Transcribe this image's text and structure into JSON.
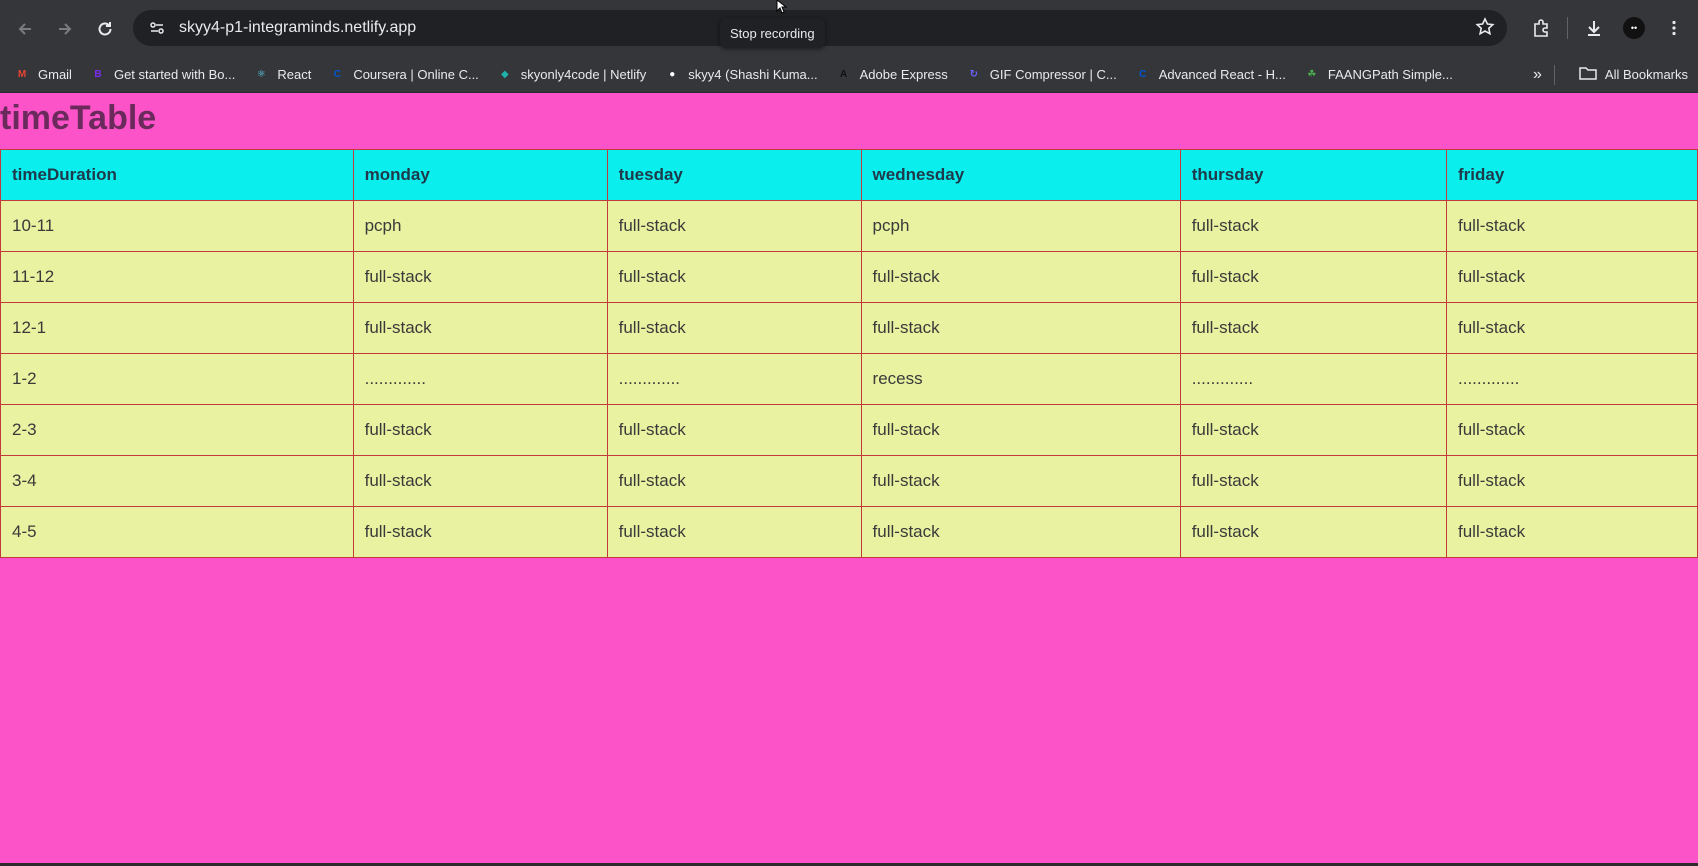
{
  "browser": {
    "url": "skyy4-p1-integraminds.netlify.app",
    "tooltip": "Stop recording",
    "avatar_text": "••",
    "bookmarks": [
      {
        "label": "Gmail",
        "icon": "gmail-icon",
        "color": "#ea4335",
        "glyph": "M"
      },
      {
        "label": "Get started with Bo...",
        "icon": "bootstrap-icon",
        "color": "#7b2cf5",
        "glyph": "B"
      },
      {
        "label": "React",
        "icon": "react-icon",
        "color": "#61dafb",
        "glyph": "⚛"
      },
      {
        "label": "Coursera | Online C...",
        "icon": "coursera-icon",
        "color": "#0056d2",
        "glyph": "C"
      },
      {
        "label": "skyonly4code | Netlify",
        "icon": "netlify-icon",
        "color": "#20b2aa",
        "glyph": "◆"
      },
      {
        "label": "skyy4 (Shashi Kuma...",
        "icon": "github-icon",
        "color": "#ffffff",
        "glyph": "●"
      },
      {
        "label": "Adobe Express",
        "icon": "adobe-express-icon",
        "color": "#111111",
        "glyph": "A"
      },
      {
        "label": "GIF Compressor | C...",
        "icon": "gif-compressor-icon",
        "color": "#6c63ff",
        "glyph": "↻"
      },
      {
        "label": "Advanced React - H...",
        "icon": "coursera-icon",
        "color": "#0056d2",
        "glyph": "C"
      },
      {
        "label": "FAANGPath Simple...",
        "icon": "faangpath-icon",
        "color": "#4caf50",
        "glyph": "☘"
      }
    ],
    "all_bookmarks_label": "All Bookmarks"
  },
  "page": {
    "title": "timeTable",
    "background": "#fc54c8",
    "header_color": "#0aeeee",
    "cell_color": "#e8f2a0",
    "headers": [
      "timeDuration",
      "monday",
      "tuesday",
      "wednesday",
      "thursday",
      "friday"
    ],
    "rows": [
      [
        "10-11",
        "pcph",
        "full-stack",
        "pcph",
        "full-stack",
        "full-stack"
      ],
      [
        "11-12",
        "full-stack",
        "full-stack",
        "full-stack",
        "full-stack",
        "full-stack"
      ],
      [
        "12-1",
        "full-stack",
        "full-stack",
        "full-stack",
        "full-stack",
        "full-stack"
      ],
      [
        "1-2",
        ".............",
        ".............",
        "recess",
        ".............",
        "............."
      ],
      [
        "2-3",
        "full-stack",
        "full-stack",
        "full-stack",
        "full-stack",
        "full-stack"
      ],
      [
        "3-4",
        "full-stack",
        "full-stack",
        "full-stack",
        "full-stack",
        "full-stack"
      ],
      [
        "4-5",
        "full-stack",
        "full-stack",
        "full-stack",
        "full-stack",
        "full-stack"
      ]
    ]
  }
}
